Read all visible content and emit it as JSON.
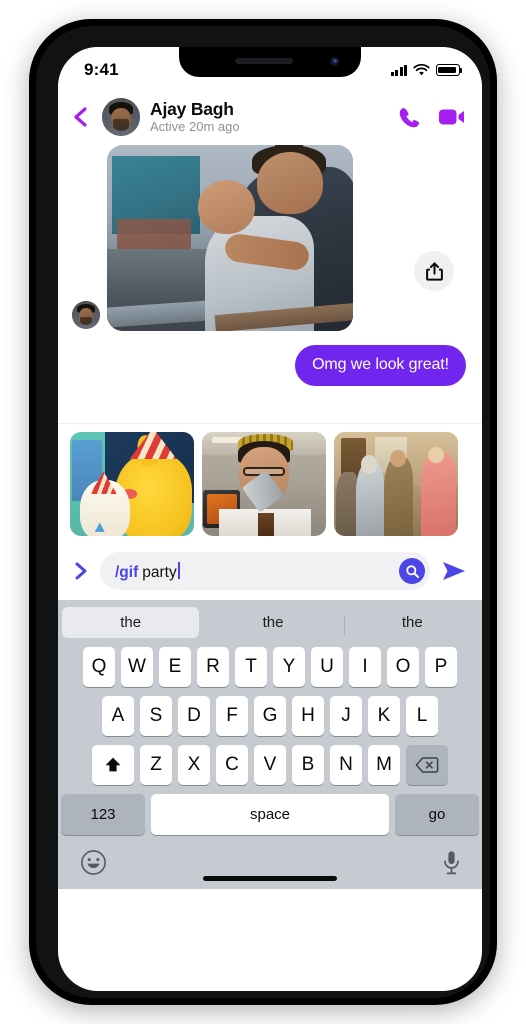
{
  "status_bar": {
    "time": "9:41",
    "signal_icon": "cellular-signal-icon",
    "wifi_icon": "wifi-icon",
    "battery_icon": "battery-full-icon"
  },
  "chat_header": {
    "back_icon": "back-chevron-icon",
    "avatar": "contact-avatar",
    "name": "Ajay Bagh",
    "status": "Active 20m ago",
    "call_icon": "phone-call-icon",
    "video_icon": "video-camera-icon",
    "accent_color": "#a61ff0"
  },
  "conversation": {
    "photo_message": {
      "sender_avatar": "sender-avatar",
      "alt": "photo-message-couple-on-balcony",
      "share_icon": "share-upload-icon"
    },
    "sent_message": {
      "text": "Omg we look great!",
      "bubble_color": "#7126ef"
    }
  },
  "gif_carousel": {
    "items": [
      {
        "name": "gif-pikachu-party",
        "label": "Pikachu party"
      },
      {
        "name": "gif-office-party-blower",
        "label": "Office party blower"
      },
      {
        "name": "gif-dancing-people",
        "label": "Dancing people"
      }
    ]
  },
  "input_bar": {
    "expand_icon": "expand-chevron-icon",
    "command": "/gif",
    "query": "party",
    "search_icon": "search-icon",
    "send_icon": "send-arrow-icon",
    "accent_color": "#4b46e5"
  },
  "keyboard": {
    "suggestions": [
      "the",
      "the",
      "the"
    ],
    "row1": [
      "Q",
      "W",
      "E",
      "R",
      "T",
      "Y",
      "U",
      "I",
      "O",
      "P"
    ],
    "row2": [
      "A",
      "S",
      "D",
      "F",
      "G",
      "H",
      "J",
      "K",
      "L"
    ],
    "row3": [
      "Z",
      "X",
      "C",
      "V",
      "B",
      "N",
      "M"
    ],
    "shift_icon": "shift-up-arrow-icon",
    "backspace_icon": "backspace-delete-icon",
    "numbers_key": "123",
    "space_key": "space",
    "go_key": "go",
    "emoji_icon": "emoji-smiley-icon",
    "dictation_icon": "microphone-icon",
    "background_color": "#c6cbd2"
  }
}
